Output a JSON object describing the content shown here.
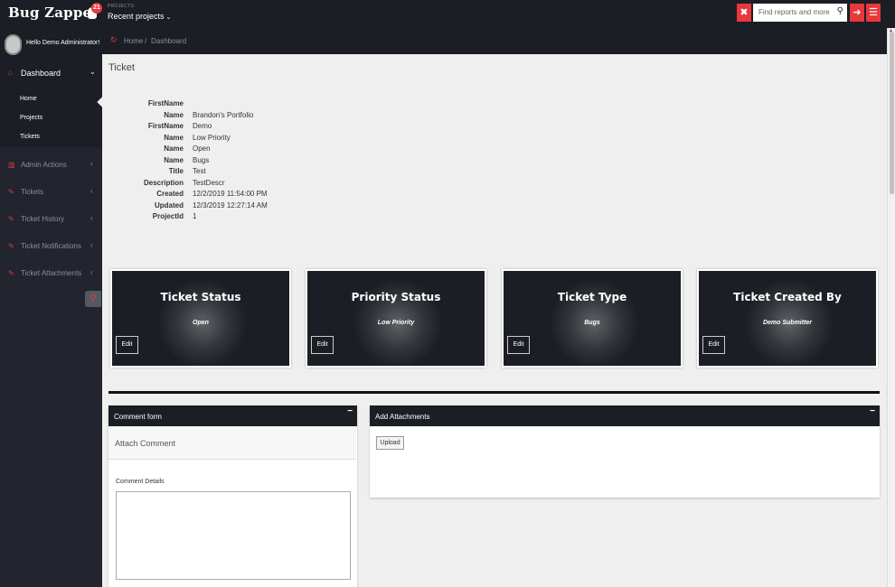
{
  "app": {
    "brand": "Bug Zapper",
    "notification_count": "21",
    "projects_label": "PROJECTS:",
    "projects_select": "Recent projects",
    "search_placeholder": "Find reports and more"
  },
  "sidebar": {
    "greeting": "Hello Demo Administrator!",
    "dashboard": "Dashboard",
    "sub_items": [
      "Home",
      "Projects",
      "Tickets"
    ],
    "items": [
      "Admin Actions",
      "Tickets",
      "Ticket History",
      "Ticket Notifications",
      "Ticket Attachments"
    ]
  },
  "breadcrumb": {
    "home": "Home",
    "separator": "/",
    "current": "Dashboard"
  },
  "page": {
    "title": "Ticket",
    "details": [
      {
        "key": "FirstName",
        "value": ""
      },
      {
        "key": "Name",
        "value": "Brandon's Portfolio"
      },
      {
        "key": "FirstName",
        "value": "Demo"
      },
      {
        "key": "Name",
        "value": "Low Priority"
      },
      {
        "key": "Name",
        "value": "Open"
      },
      {
        "key": "Name",
        "value": "Bugs"
      },
      {
        "key": "Title",
        "value": "Test"
      },
      {
        "key": "Description",
        "value": "TestDescr"
      },
      {
        "key": "Created",
        "value": "12/2/2019 11:54:00 PM"
      },
      {
        "key": "Updated",
        "value": "12/3/2019 12:27:14 AM"
      },
      {
        "key": "ProjectId",
        "value": "1"
      }
    ],
    "cards": [
      {
        "title": "Ticket Status",
        "value": "Open",
        "button": "Edit"
      },
      {
        "title": "Priority Status",
        "value": "Low Priority",
        "button": "Edit"
      },
      {
        "title": "Ticket Type",
        "value": "Bugs",
        "button": "Edit"
      },
      {
        "title": "Ticket Created By",
        "value": "Demo Submitter",
        "button": "Edit"
      }
    ],
    "comment_panel": {
      "title": "Comment form",
      "minimize": "−",
      "section": "Attach Comment",
      "details_label": "Comment Details"
    },
    "attachments_panel": {
      "title": "Add Attachments",
      "minimize": "−",
      "upload_button": "Upload"
    }
  },
  "colors": {
    "accent": "#e8383d",
    "dark": "#1b1e24",
    "sidebar": "#22252d"
  }
}
